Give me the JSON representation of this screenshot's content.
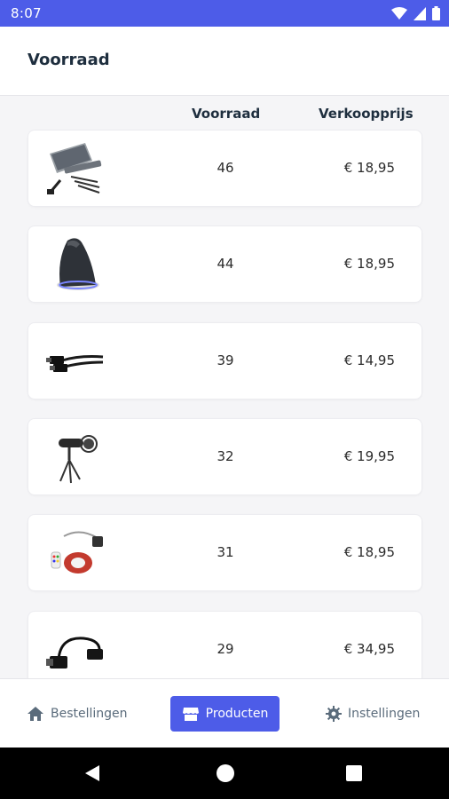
{
  "status_bar": {
    "time": "8:07"
  },
  "header": {
    "title": "Voorraad"
  },
  "columns": {
    "stock": "Voorraad",
    "price": "Verkoopprijs"
  },
  "products": [
    {
      "image_icon": "usb-c-hub-icon",
      "stock": "46",
      "price": "€ 18,95"
    },
    {
      "image_icon": "vertical-mouse-icon",
      "stock": "44",
      "price": "€ 18,95"
    },
    {
      "image_icon": "hdmi-cable-icon",
      "stock": "39",
      "price": "€ 14,95"
    },
    {
      "image_icon": "microphone-tripod-icon",
      "stock": "32",
      "price": "€ 19,95"
    },
    {
      "image_icon": "led-strip-icon",
      "stock": "31",
      "price": "€ 18,95"
    },
    {
      "image_icon": "displayport-adapter-icon",
      "stock": "29",
      "price": "€ 34,95"
    }
  ],
  "bottom_nav": {
    "orders": {
      "label": "Bestellingen",
      "icon": "home-icon"
    },
    "products": {
      "label": "Producten",
      "icon": "store-icon",
      "active": true
    },
    "settings": {
      "label": "Instellingen",
      "icon": "gear-icon"
    }
  },
  "colors": {
    "accent": "#4d5ce8",
    "text": "#1e2e3e",
    "background": "#f5f5f7"
  }
}
